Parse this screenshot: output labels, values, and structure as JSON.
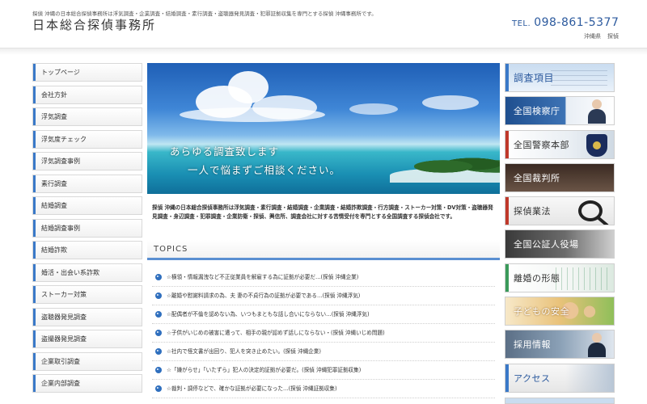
{
  "header": {
    "tagline": "探偵 沖縄の日本総合探偵事務所は浮気調査・企業調査・結婚調査・素行調査・盗聴器発見調査・犯罪証拠収集を専門とする探偵 沖縄事務所です。",
    "site_title": "日本総合探偵事務所",
    "tel_label": "TEL.",
    "tel_number": "098-861-5377",
    "region": [
      "沖縄県",
      "探偵"
    ]
  },
  "sidebar": {
    "items": [
      {
        "label": "トップページ"
      },
      {
        "label": "会社方針"
      },
      {
        "label": "浮気調査"
      },
      {
        "label": "浮気度チェック"
      },
      {
        "label": "浮気調査事例"
      },
      {
        "label": "素行調査"
      },
      {
        "label": "結婚調査"
      },
      {
        "label": "結婚調査事例"
      },
      {
        "label": "結婚詐欺"
      },
      {
        "label": "婚活・出会い系詐欺"
      },
      {
        "label": "ストーカー対策"
      },
      {
        "label": "盗聴器発見調査"
      },
      {
        "label": "盗撮器発見調査"
      },
      {
        "label": "企業取引調査"
      },
      {
        "label": "企業内部調査"
      }
    ]
  },
  "hero": {
    "line1": "あらゆる調査致します",
    "line2": "一人で悩まずご相談ください。"
  },
  "intro": {
    "text": "探偵 沖縄の日本総合探偵事務所は浮気調査・素行調査・結婚調査・企業調査・結婚詐欺調査・行方調査・ストーカー対策・DV対策・盗聴器発見調査・身辺調査・犯罪調査・企業防衛・探偵、興信所、調査会社に対する苦情受付を専門とする全国調査する探偵会社です。"
  },
  "topics": {
    "heading": "TOPICS",
    "items": [
      {
        "text": "☆横領・情報漏洩など不正従業員を解雇する為に証拠が必要だ…(探偵 沖縄企業)"
      },
      {
        "text": "☆離婚や慰謝料請求の為、夫 妻の不貞行為の証拠が必要である…(探偵 沖縄浮気)"
      },
      {
        "text": "☆配偶者が不倫を認めない為、いつもまともな話し合いにならない…(探偵 沖縄浮気)"
      },
      {
        "text": "☆子供がいじめの被害に遭って、相手の親が認めず話しにならない・(探偵 沖縄いじめ問題)"
      },
      {
        "text": "☆社内で怪文書が出回り、犯人を突き止めたい。(探偵 沖縄企業)"
      },
      {
        "text": "☆「嫌がらせ」「いたずら」犯人の決定的証拠が必要だ。(探偵 沖縄犯罪証拠収集)"
      },
      {
        "text": "☆裁判・調停などで、確かな証拠が必要になった…(探偵 沖縄証拠収集)"
      }
    ]
  },
  "banners": {
    "items": [
      {
        "label": "調査項目",
        "color": "#2c5a9e"
      },
      {
        "label": "全国検察庁",
        "color": "#ffffff"
      },
      {
        "label": "全国警察本部",
        "color": "#333333"
      },
      {
        "label": "全国裁判所",
        "color": "#ffffff"
      },
      {
        "label": "探偵業法",
        "color": "#333333"
      },
      {
        "label": "全国公証人役場",
        "color": "#ffffff"
      },
      {
        "label": "離婚の形態",
        "color": "#333333"
      },
      {
        "label": "子どもの安全",
        "color": "#ffffff"
      },
      {
        "label": "採用情報",
        "color": "#ffffff"
      },
      {
        "label": "アクセス",
        "color": "#2c5a9e"
      }
    ]
  },
  "colors": {
    "accent": "#3a79c8",
    "tel": "#2c5a9e",
    "topic_underline": "#5a8fd1"
  }
}
